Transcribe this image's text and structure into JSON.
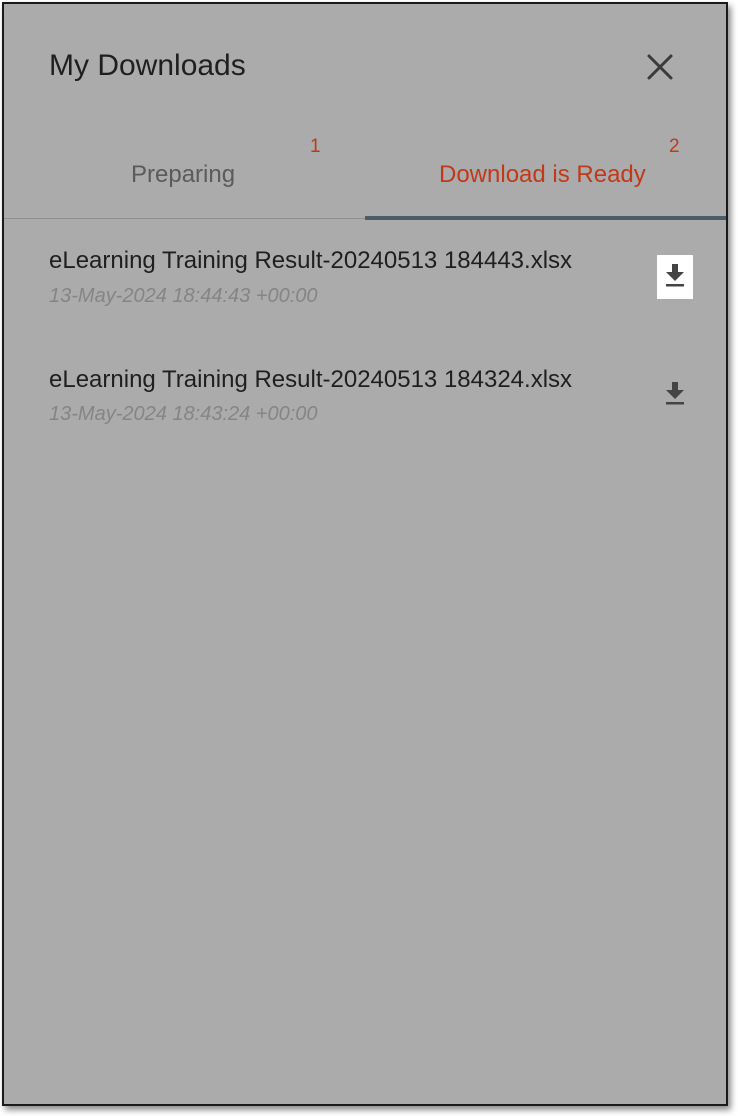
{
  "panel": {
    "title": "My Downloads",
    "close_icon": "close-icon"
  },
  "tabs": [
    {
      "label": "Preparing",
      "count": "1",
      "active": false
    },
    {
      "label": "Download is Ready",
      "count": "2",
      "active": true
    }
  ],
  "downloads": [
    {
      "name": "eLearning Training Result-20240513 184443.xlsx",
      "timestamp": "13-May-2024 18:44:43 +00:00",
      "icon": "download-icon",
      "highlighted": true
    },
    {
      "name": "eLearning Training Result-20240513 184324.xlsx",
      "timestamp": "13-May-2024 18:43:24 +00:00",
      "icon": "download-icon",
      "highlighted": false
    }
  ],
  "colors": {
    "panel_background": "#ababab",
    "active_tab_text": "#c0391b",
    "inactive_tab_text": "#5b5b5b",
    "active_tab_indicator": "#4b5c68",
    "badge_count": "#c0391b",
    "timestamp_text": "#858585"
  }
}
